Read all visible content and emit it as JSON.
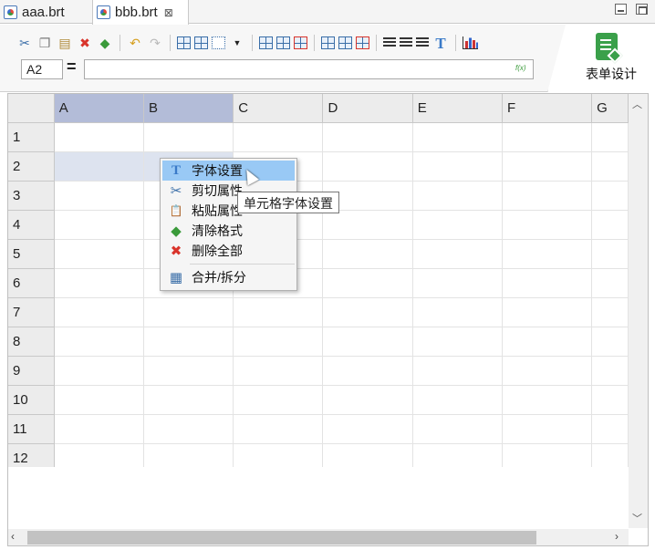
{
  "tabs": [
    {
      "label": "aaa.brt"
    },
    {
      "label": "bbb.brt",
      "close": "⊠"
    }
  ],
  "toolbar": {
    "icons": [
      "scissors-icon",
      "copy-icon",
      "paste-icon",
      "delete-icon",
      "eraser-icon",
      "undo-icon",
      "redo-icon",
      "merge-cells-icon",
      "insert-grid-icon",
      "border-icon",
      "dropdown-arrow-icon",
      "insert-row-above-icon",
      "insert-row-below-icon",
      "delete-row-icon",
      "insert-col-left-icon",
      "insert-col-right-icon",
      "delete-col-icon",
      "align-left-icon",
      "align-center-icon",
      "align-right-icon",
      "font-icon",
      "chart-icon"
    ]
  },
  "formula": {
    "cell_ref": "A2",
    "equals": "=",
    "value": "",
    "fx": "f(x)"
  },
  "design": {
    "label": "表单设计"
  },
  "sheet": {
    "columns": [
      "A",
      "B",
      "C",
      "D",
      "E",
      "F",
      "G"
    ],
    "rows": [
      "1",
      "2",
      "3",
      "4",
      "5",
      "6",
      "7",
      "8",
      "9",
      "10",
      "11",
      "12"
    ],
    "selected_cell": "A2"
  },
  "context_menu": {
    "items": [
      {
        "label": "字体设置",
        "icon": "T"
      },
      {
        "label": "剪切属性",
        "icon": "✂"
      },
      {
        "label": "粘贴属性",
        "icon": "📋"
      },
      {
        "label": "清除格式",
        "icon": "◆"
      },
      {
        "label": "删除全部",
        "icon": "✖"
      },
      {
        "label": "合并/拆分",
        "icon": "▦"
      }
    ]
  },
  "tooltip": "单元格字体设置",
  "colors": {
    "accent": "#3aa04a",
    "selection": "#99c9f5",
    "header_selected": "#b3bcd8"
  }
}
